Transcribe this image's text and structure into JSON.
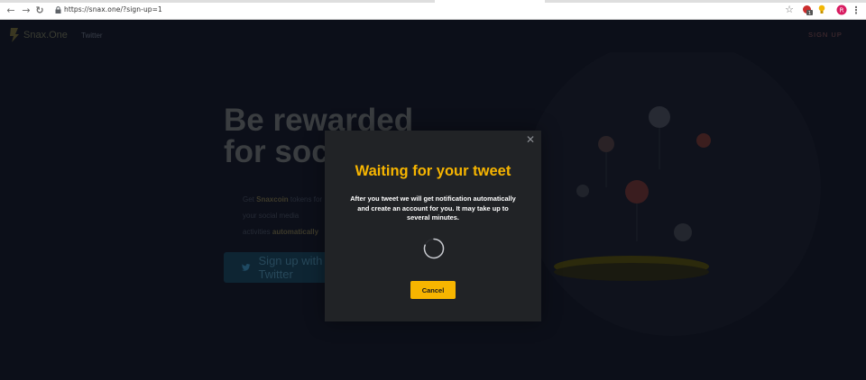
{
  "browser": {
    "url": "https://snax.one/?sign-up=1",
    "back_icon": "←",
    "forward_icon": "→",
    "reload_icon": "↻",
    "star_icon": "☆",
    "menu_icon": "⋮",
    "profile_initial": "R",
    "ext_badge": "1"
  },
  "site": {
    "logo_text": "Snax.One",
    "nav_link": "Twitter",
    "signup_link": "SIGN UP"
  },
  "hero": {
    "title_line1": "Be rewarded",
    "title_line2": "for social activity",
    "desc_line1_prefix": "Get ",
    "desc_line1_highlight": "Snaxcoin",
    "desc_line1_suffix": " tokens for",
    "desc_line2": "your social media",
    "desc_line3_prefix": "activities ",
    "desc_line3_highlight": "automatically",
    "twitter_button": "Sign up with Twitter"
  },
  "modal": {
    "close_icon": "✕",
    "title": "Waiting for your tweet",
    "body": "After you tweet we will get notification automatically and create an account for you. It may take up to several minutes.",
    "cancel_label": "Cancel"
  },
  "colors": {
    "accent": "#f7b500",
    "modal_bg": "#212326",
    "page_bg": "#0c0f19"
  }
}
